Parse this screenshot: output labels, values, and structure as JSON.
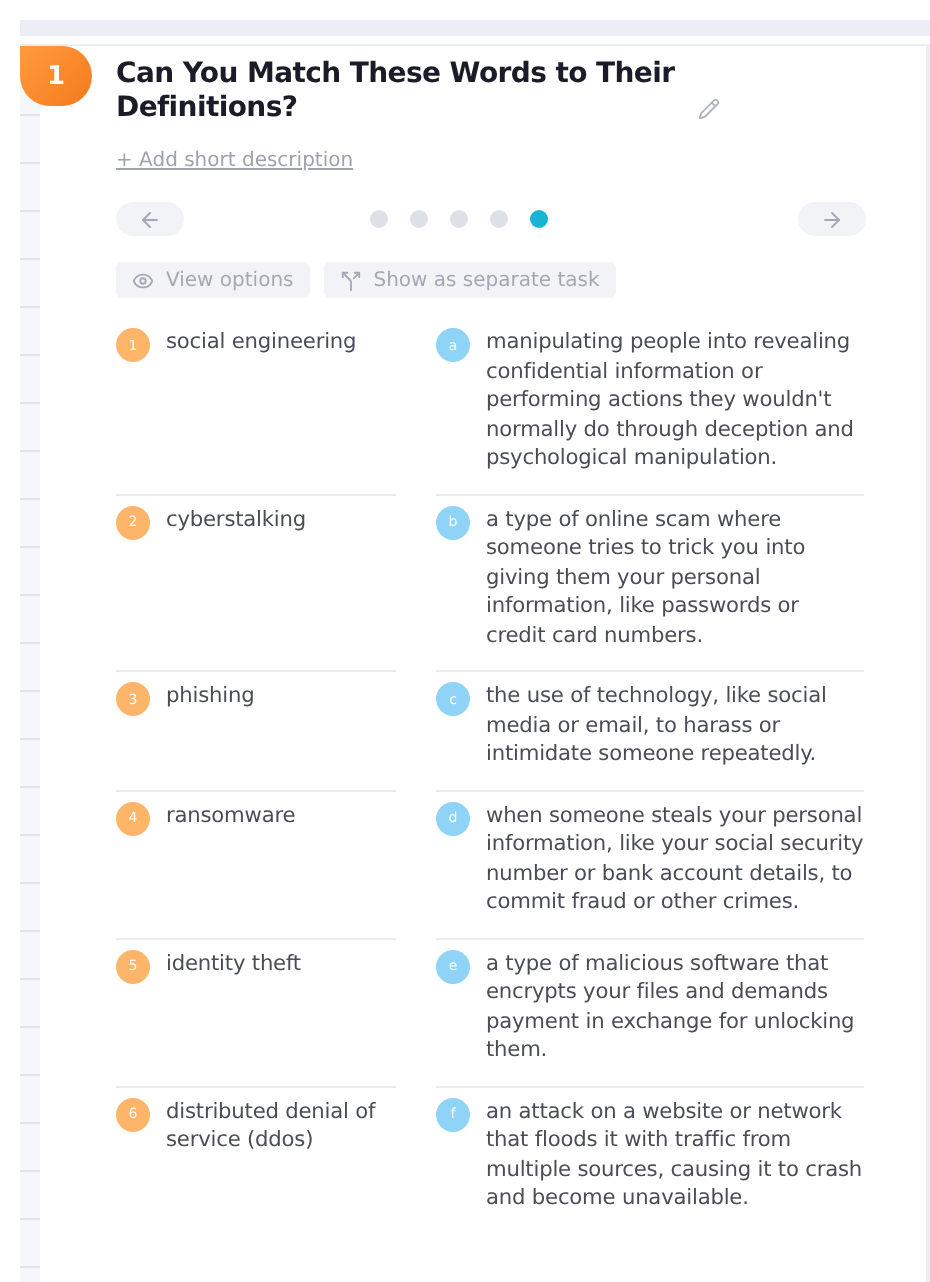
{
  "task": {
    "number": "1",
    "title": "Can You Match These Words to Their Definitions?",
    "add_description": "+ Add short description"
  },
  "pager": {
    "dots": [
      {
        "selected": false
      },
      {
        "selected": false
      },
      {
        "selected": false
      },
      {
        "selected": false
      },
      {
        "selected": true
      }
    ]
  },
  "actions": [
    "View options",
    "Show as separate task"
  ],
  "pairs": [
    {
      "term_number": "1",
      "term": "social engineering",
      "definition_letter": "a",
      "definition": "manipulating people into revealing confidential information or performing actions they wouldn't normally do through deception and psychological manipulation."
    },
    {
      "term_number": "2",
      "term": "cyberstalking",
      "definition_letter": "b",
      "definition": "a type of online scam where someone tries to trick you into giving them your personal information, like passwords or credit card numbers."
    },
    {
      "term_number": "3",
      "term": "phishing",
      "definition_letter": "c",
      "definition": "the use of technology, like social media or email, to harass or intimidate someone repeatedly."
    },
    {
      "term_number": "4",
      "term": "ransomware",
      "definition_letter": "d",
      "definition": "when someone steals your personal information, like your social security number or bank account details, to commit fraud or other crimes."
    },
    {
      "term_number": "5",
      "term": "identity theft",
      "definition_letter": "e",
      "definition": "a type of malicious software that encrypts your files and demands payment in exchange for unlocking them."
    },
    {
      "term_number": "6",
      "term": "distributed denial of service (ddos)",
      "definition_letter": "f",
      "definition": "an attack on a website or network that floods it with traffic from multiple sources, causing it to crash and become unavailable."
    }
  ]
}
